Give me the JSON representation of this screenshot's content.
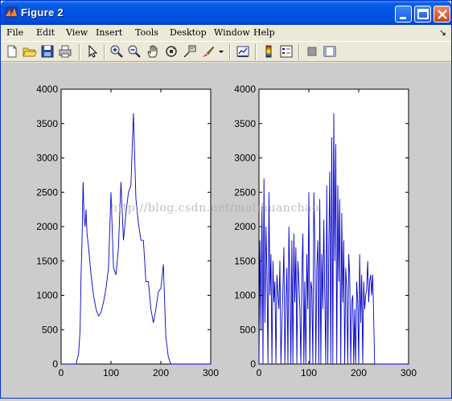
{
  "window": {
    "title": "Figure 2",
    "colors": {
      "titlebar": "#0054e3",
      "figure_bg": "#cccccc",
      "plot_line": "#0000cc"
    }
  },
  "menubar": {
    "items": [
      "File",
      "Edit",
      "View",
      "Insert",
      "Tools",
      "Desktop",
      "Window",
      "Help"
    ],
    "overflow_arrow": "↘"
  },
  "toolbar": {
    "icons": [
      "new-figure-icon",
      "open-file-icon",
      "save-icon",
      "print-icon",
      "edit-plot-arrow-icon",
      "zoom-in-icon",
      "zoom-out-icon",
      "pan-hand-icon",
      "rotate-3d-icon",
      "data-cursor-icon",
      "brush-icon",
      "brush-dropdown-icon",
      "link-plot-icon",
      "colorbar-icon",
      "legend-icon",
      "hide-plot-tools-icon",
      "show-plot-tools-icon"
    ]
  },
  "watermark": "http://blog.csdn.net/molihuanchao",
  "chart_data": [
    {
      "type": "line",
      "x": [
        0,
        20,
        30,
        35,
        38,
        40,
        42,
        44,
        46,
        48,
        50,
        52,
        55,
        60,
        65,
        70,
        75,
        80,
        85,
        90,
        95,
        100,
        105,
        110,
        115,
        120,
        125,
        130,
        135,
        140,
        145,
        150,
        155,
        160,
        165,
        170,
        175,
        180,
        185,
        190,
        195,
        200,
        205,
        210,
        215,
        220,
        230,
        300
      ],
      "y": [
        0,
        0,
        0,
        150,
        500,
        1300,
        1800,
        2650,
        2150,
        2000,
        2250,
        1900,
        1700,
        1300,
        1000,
        800,
        700,
        750,
        900,
        1100,
        1400,
        2500,
        1400,
        1300,
        1700,
        2650,
        1800,
        2200,
        2500,
        2600,
        3650,
        2400,
        2050,
        1800,
        1800,
        1200,
        1200,
        800,
        600,
        800,
        1050,
        1100,
        1450,
        400,
        100,
        0,
        0,
        0
      ],
      "xticks": [
        "0",
        "100",
        "200",
        "300"
      ],
      "yticks": [
        "0",
        "500",
        "1000",
        "1500",
        "2000",
        "2500",
        "3000",
        "3500",
        "4000"
      ],
      "xlim": [
        0,
        300
      ],
      "ylim": [
        0,
        4000
      ],
      "grid": false
    },
    {
      "type": "line",
      "x": [
        0,
        2,
        4,
        6,
        8,
        10,
        12,
        14,
        16,
        18,
        20,
        22,
        24,
        26,
        28,
        30,
        32,
        34,
        36,
        38,
        40,
        42,
        44,
        46,
        48,
        50,
        52,
        54,
        56,
        58,
        60,
        62,
        64,
        66,
        68,
        70,
        72,
        74,
        76,
        78,
        80,
        82,
        84,
        86,
        88,
        90,
        92,
        94,
        96,
        98,
        100,
        102,
        104,
        106,
        108,
        110,
        112,
        114,
        116,
        118,
        120,
        122,
        124,
        126,
        128,
        130,
        132,
        134,
        136,
        138,
        140,
        142,
        144,
        146,
        148,
        150,
        152,
        154,
        156,
        158,
        160,
        162,
        164,
        166,
        168,
        170,
        172,
        174,
        176,
        178,
        180,
        182,
        184,
        186,
        188,
        190,
        192,
        194,
        196,
        198,
        200,
        202,
        204,
        206,
        208,
        210,
        212,
        214,
        216,
        218,
        220,
        222,
        224,
        226,
        228,
        230,
        232,
        240,
        300
      ],
      "y": [
        0,
        1800,
        500,
        2300,
        0,
        2700,
        600,
        2000,
        1300,
        0,
        2500,
        1000,
        1600,
        0,
        1500,
        900,
        1200,
        0,
        1300,
        1000,
        800,
        1500,
        0,
        600,
        1100,
        1700,
        0,
        900,
        1400,
        0,
        2000,
        1200,
        0,
        1800,
        0,
        1900,
        900,
        1700,
        0,
        1500,
        1200,
        800,
        0,
        1300,
        1900,
        0,
        1200,
        0,
        1600,
        800,
        2500,
        0,
        1200,
        1100,
        0,
        2500,
        1800,
        0,
        1400,
        1800,
        0,
        2400,
        0,
        1600,
        800,
        2100,
        1000,
        0,
        2600,
        0,
        1700,
        2800,
        0,
        3300,
        0,
        3650,
        1500,
        3200,
        0,
        2600,
        1200,
        2400,
        0,
        2200,
        900,
        1800,
        0,
        1400,
        1100,
        0,
        1600,
        1300,
        0,
        900,
        1000,
        0,
        800,
        0,
        1200,
        900,
        0,
        1600,
        600,
        1300,
        0,
        1200,
        800,
        1000,
        1100,
        1500,
        900,
        1200,
        1300,
        1000,
        1300,
        700,
        0,
        0,
        0
      ],
      "xticks": [
        "0",
        "100",
        "200",
        "300"
      ],
      "yticks": [
        "0",
        "500",
        "1000",
        "1500",
        "2000",
        "2500",
        "3000",
        "3500",
        "4000"
      ],
      "xlim": [
        0,
        300
      ],
      "ylim": [
        0,
        4000
      ],
      "grid": false
    }
  ]
}
